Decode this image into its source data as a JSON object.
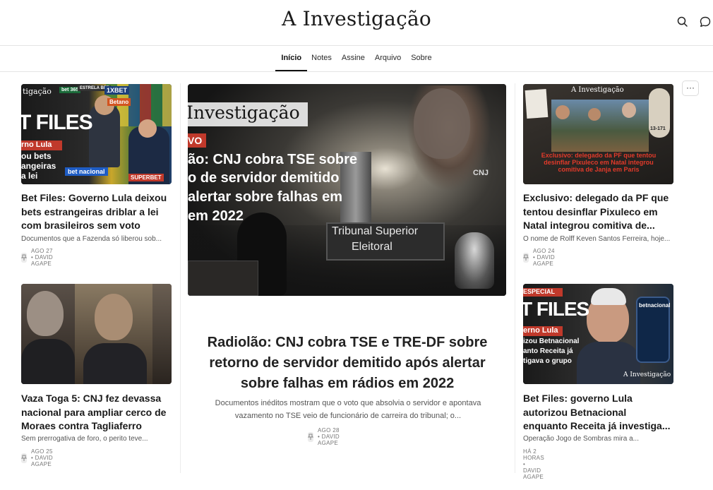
{
  "site": {
    "title": "A Investigação"
  },
  "header": {
    "search_icon": "search-icon",
    "chat_icon": "chat-bubble-icon"
  },
  "nav": {
    "items": [
      {
        "label": "Início",
        "active": true
      },
      {
        "label": "Notes"
      },
      {
        "label": "Assine"
      },
      {
        "label": "Arquivo"
      },
      {
        "label": "Sobre"
      }
    ]
  },
  "more_button": "···",
  "featured": {
    "title": "Radiolão: CNJ cobra TSE e TRE-DF sobre retorno de servidor demitido após alertar sobre falhas em rádios em 2022",
    "subtitle": "Documentos inéditos mostram que o voto que absolvia o servidor e apontava vazamento no TSE veio de funcionário de carreira do tribunal; o...",
    "meta": "AGO 28 • DAVID AGAPE",
    "image": {
      "brand": "Investigação",
      "tag": "VO",
      "headline_lines": [
        "ão: CNJ cobra TSE sobre",
        "o de servidor demitido",
        "alertar sobre falhas em",
        "em 2022"
      ],
      "sign_line1": "Tribunal Superior",
      "sign_line2": "Eleitoral",
      "cnj": "CNJ"
    }
  },
  "left_cards": [
    {
      "title": "Bet Files: Governo Lula deixou bets estrangeiras driblar a lei com brasileiros sem voto",
      "subtitle": "Documentos que a Fazenda só liberou sob...",
      "meta": "AGO 27 • DAVID AGAPE",
      "image": {
        "brand": "tigação",
        "headline": "T FILES",
        "lines": [
          "rno Lula",
          "ou bets",
          "angeiras",
          "a lei"
        ],
        "logos": [
          "bet 365",
          "ESTRELA BET",
          "1XBET",
          "Betano",
          "SUPERBET",
          "bet nacional"
        ]
      }
    },
    {
      "title": "Vaza Toga 5: CNJ fez devassa nacional para ampliar cerco de Moraes contra Tagliaferro",
      "subtitle": "Sem prerrogativa de foro, o perito teve...",
      "meta": "AGO 25 • DAVID AGAPE"
    }
  ],
  "right_cards": [
    {
      "title": "Exclusivo: delegado da PF que tentou desinflar Pixuleco em Natal integrou comitiva de...",
      "subtitle": "O nome de Rolff Keven Santos Ferreira, hoje...",
      "meta": "AGO 24 • DAVID AGAPE",
      "image": {
        "brand": "A Investigação",
        "caption": "Exclusivo: delegado da PF que tentou desinflar Pixuleco em Natal integrou comitiva de Janja em Paris",
        "badge": "13-171"
      }
    },
    {
      "title": "Bet Files: governo Lula autorizou Betnacional enquanto Receita já investiga...",
      "subtitle": "Operação Jogo de Sombras mira a...",
      "meta": "HÁ 2 HORAS • DAVID AGAPE",
      "image": {
        "tag": "ESPECIAL",
        "headline": "T FILES",
        "lines": [
          "erno Lula",
          "izou Betnacional",
          "anto Receita já",
          "tigava o grupo"
        ],
        "brand": "A Investigação",
        "logo": "betnacional"
      }
    }
  ],
  "colors": {
    "accent": "#c0392b",
    "text": "#1a1a1a",
    "muted": "#777777"
  }
}
